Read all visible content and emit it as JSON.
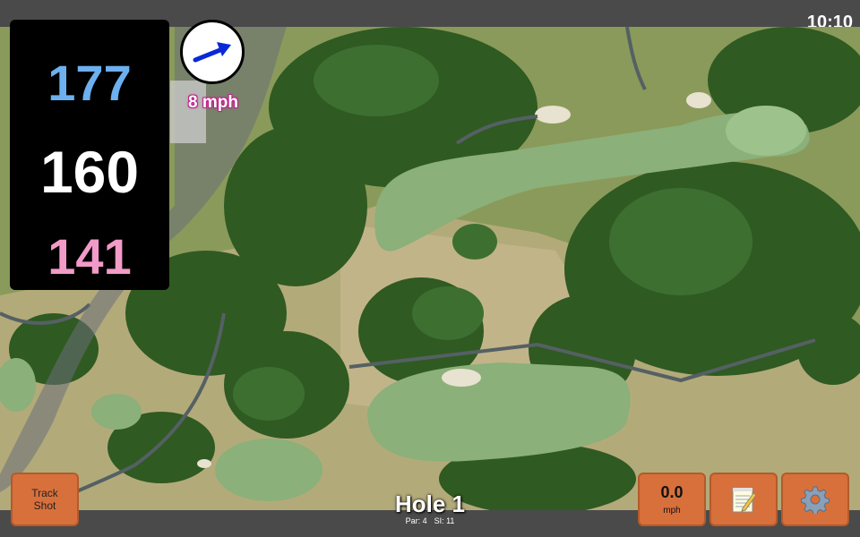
{
  "status": {
    "clock": "10:10"
  },
  "distances": {
    "back": "177",
    "middle": "160",
    "front": "141"
  },
  "wind": {
    "speed_label": "8 mph",
    "direction_icon": "wind-arrow-icon"
  },
  "hole": {
    "title": "Hole 1",
    "par": "Par: 4",
    "stroke_index": "SI: 11"
  },
  "buttons": {
    "track_shot_line1": "Track",
    "track_shot_line2": "Shot",
    "speed_value": "0.0",
    "speed_unit": "mph",
    "notes_icon": "notepad-icon",
    "settings_icon": "gear-icon"
  },
  "colors": {
    "back_distance": "#6cb0f0",
    "middle_distance": "#ffffff",
    "front_distance": "#f29ac8",
    "button_fill": "#d8703c",
    "wind_label_outline": "#c0208a"
  }
}
